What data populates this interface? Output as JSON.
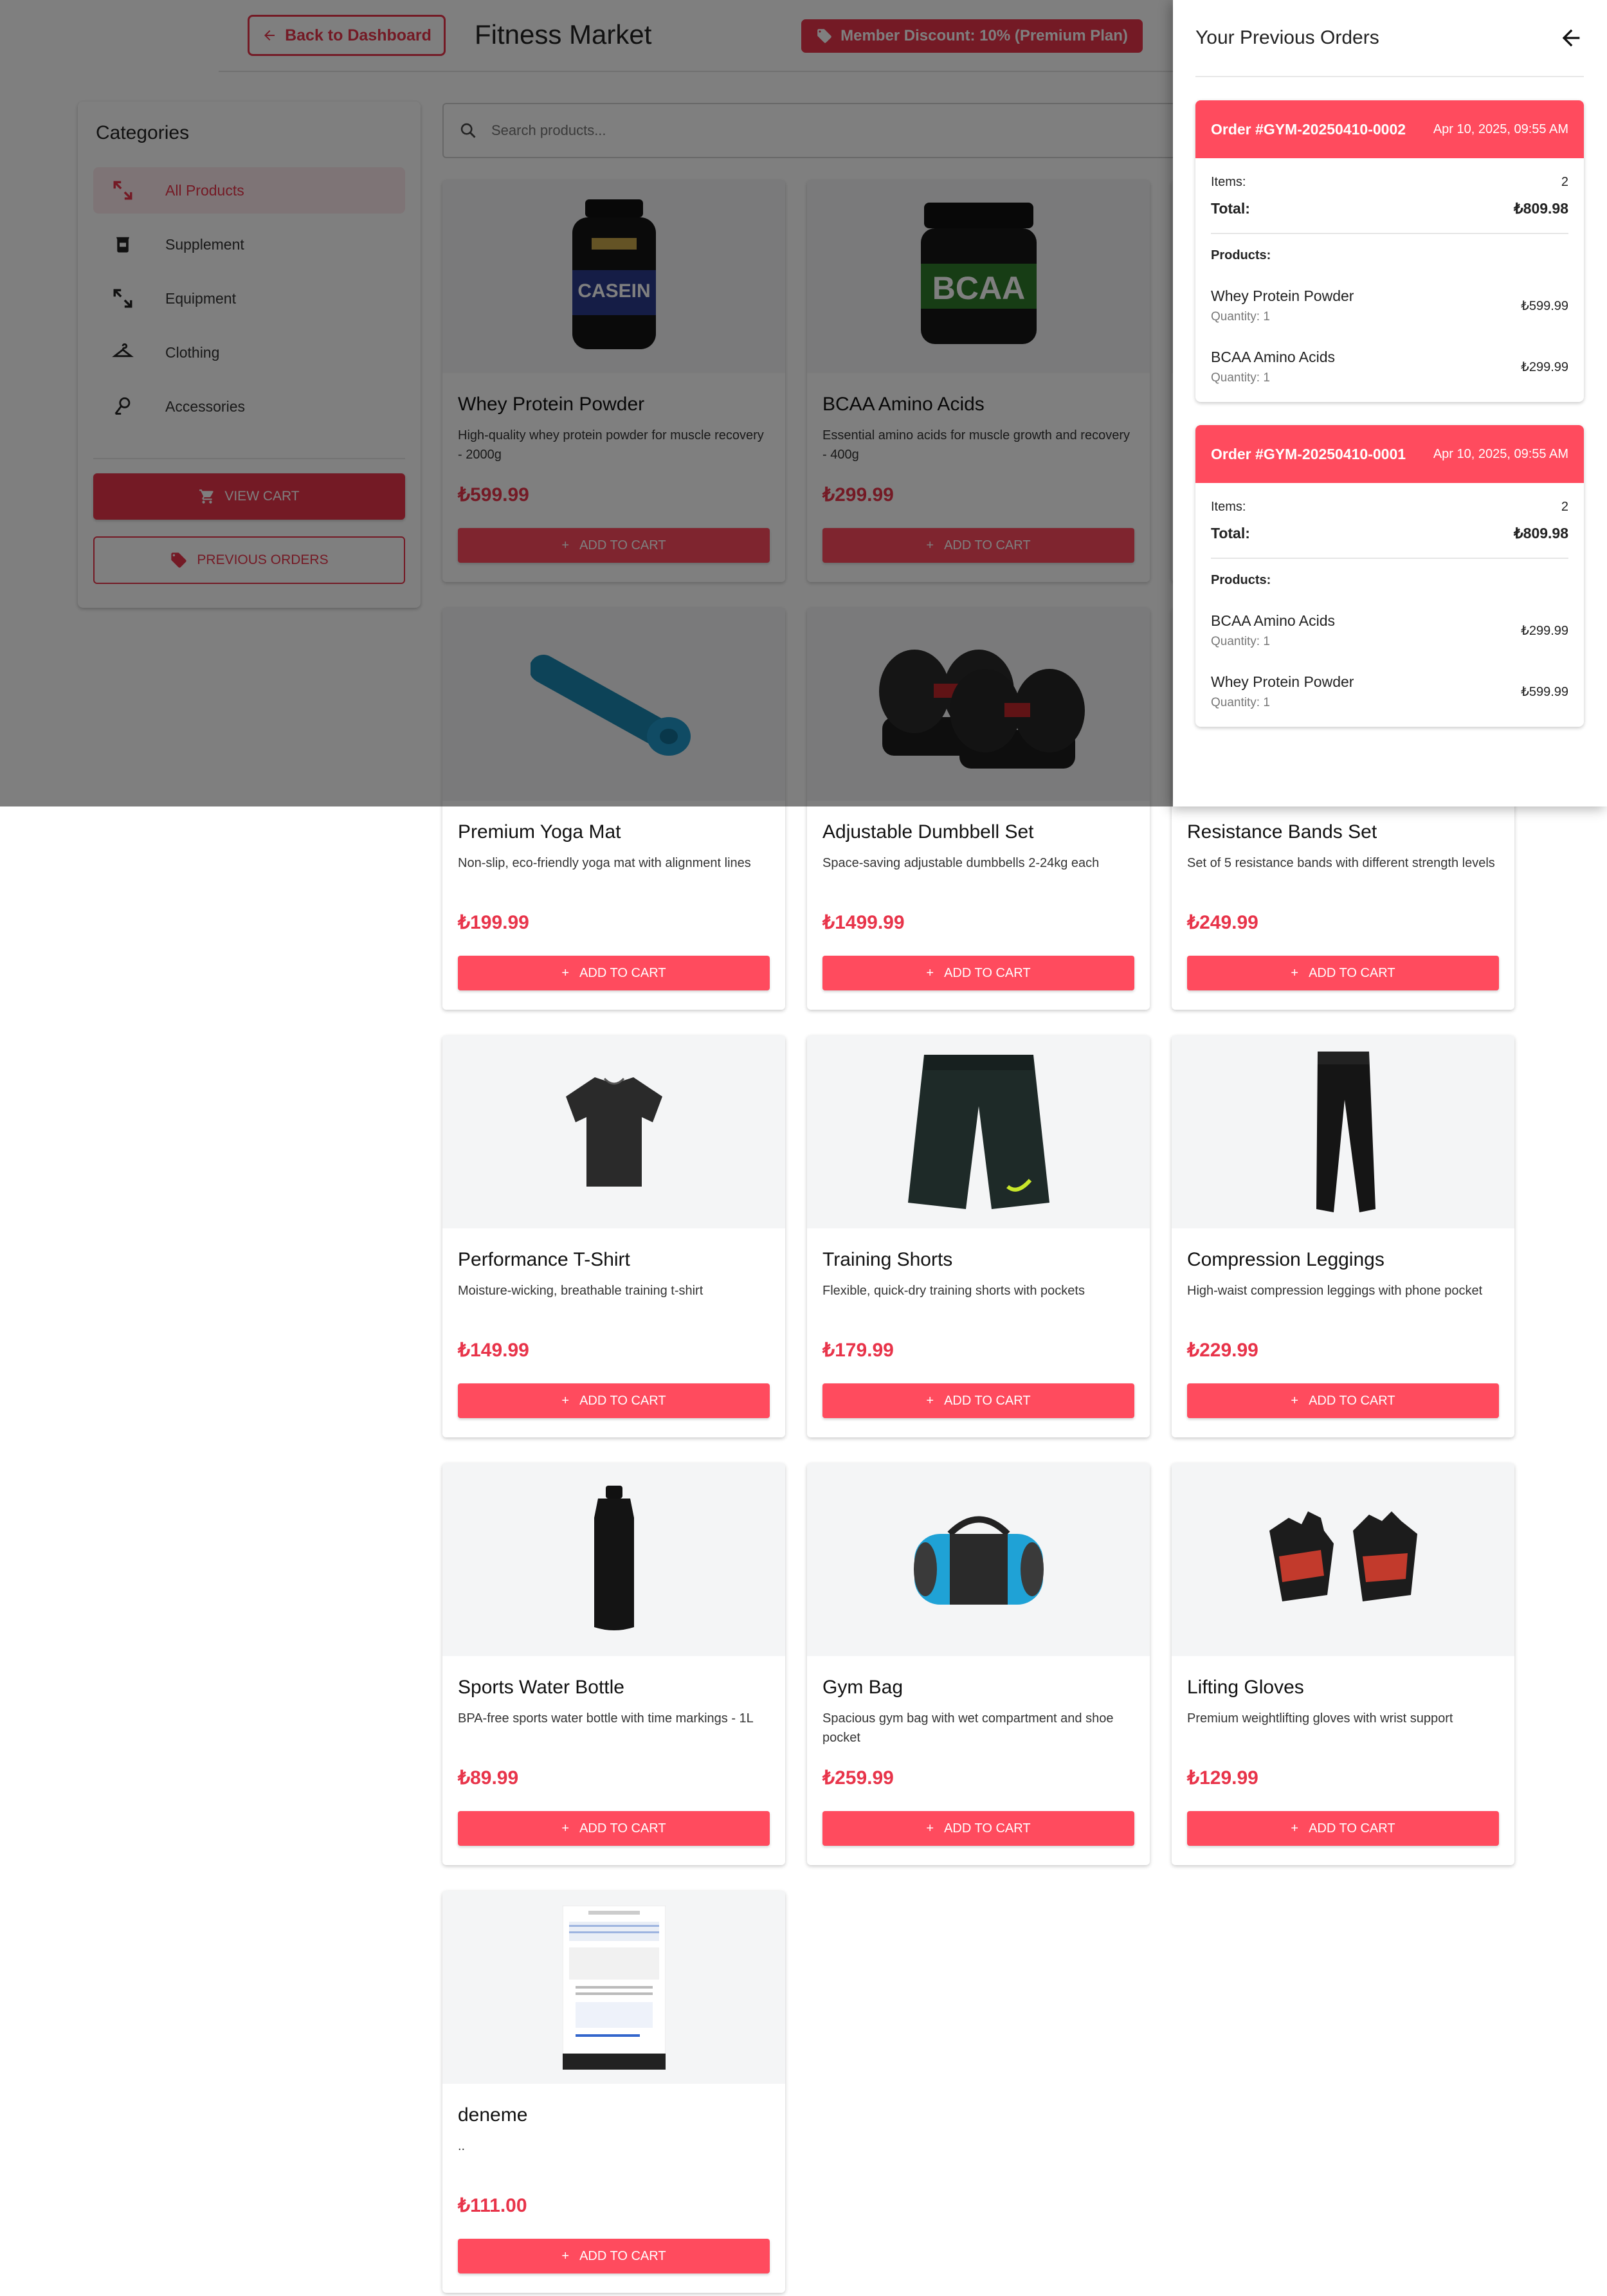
{
  "header": {
    "back_label": "Back to Dashboard",
    "title": "Fitness Market",
    "discount_badge": "Member Discount: 10% (Premium Plan)"
  },
  "sidebar": {
    "title": "Categories",
    "items": [
      {
        "label": "All Products",
        "icon": "all-products-icon",
        "active": true
      },
      {
        "label": "Supplement",
        "icon": "supplement-icon",
        "active": false
      },
      {
        "label": "Equipment",
        "icon": "equipment-icon",
        "active": false
      },
      {
        "label": "Clothing",
        "icon": "clothing-icon",
        "active": false
      },
      {
        "label": "Accessories",
        "icon": "accessories-icon",
        "active": false
      }
    ],
    "view_cart_label": "VIEW CART",
    "previous_orders_label": "PREVIOUS ORDERS"
  },
  "search": {
    "placeholder": "Search products..."
  },
  "products": [
    {
      "name": "Whey Protein Powder",
      "description": "High-quality whey protein powder for muscle recovery - 2000g",
      "price": "₺599.99",
      "button": "ADD TO CART",
      "image": "casein-tub"
    },
    {
      "name": "BCAA Amino Acids",
      "description": "Essential amino acids for muscle growth and recovery - 400g",
      "price": "₺299.99",
      "button": "ADD TO CART",
      "image": "bcaa-tub"
    },
    {
      "name": "",
      "description": "",
      "price": "",
      "button": "",
      "image": "hidden"
    },
    {
      "name": "Premium Yoga Mat",
      "description": "Non-slip, eco-friendly yoga mat with alignment lines",
      "price": "₺199.99",
      "button": "ADD TO CART",
      "image": "yoga-mat"
    },
    {
      "name": "Adjustable Dumbbell Set",
      "description": "Space-saving adjustable dumbbells 2-24kg each",
      "price": "₺1499.99",
      "button": "ADD TO CART",
      "image": "dumbbells"
    },
    {
      "name": "Resistance Bands Set",
      "description": "Set of 5 resistance bands with different strength levels",
      "price": "₺249.99",
      "button": "ADD TO CART",
      "image": "bands"
    },
    {
      "name": "Performance T-Shirt",
      "description": "Moisture-wicking, breathable training t-shirt",
      "price": "₺149.99",
      "button": "ADD TO CART",
      "image": "tshirt"
    },
    {
      "name": "Training Shorts",
      "description": "Flexible, quick-dry training shorts with pockets",
      "price": "₺179.99",
      "button": "ADD TO CART",
      "image": "shorts"
    },
    {
      "name": "Compression Leggings",
      "description": "High-waist compression leggings with phone pocket",
      "price": "₺229.99",
      "button": "ADD TO CART",
      "image": "leggings"
    },
    {
      "name": "Sports Water Bottle",
      "description": "BPA-free sports water bottle with time markings - 1L",
      "price": "₺89.99",
      "button": "ADD TO CART",
      "image": "bottle"
    },
    {
      "name": "Gym Bag",
      "description": "Spacious gym bag with wet compartment and shoe pocket",
      "price": "₺259.99",
      "button": "ADD TO CART",
      "image": "gymbag"
    },
    {
      "name": "Lifting Gloves",
      "description": "Premium weightlifting gloves with wrist support",
      "price": "₺129.99",
      "button": "ADD TO CART",
      "image": "gloves"
    },
    {
      "name": "deneme",
      "description": "..",
      "price": "₺111.00",
      "button": "ADD TO CART",
      "image": "screenshot"
    }
  ],
  "orders_panel": {
    "title": "Your Previous Orders",
    "items_label": "Items:",
    "total_label": "Total:",
    "products_label": "Products:",
    "orders": [
      {
        "id": "Order #GYM-20250410-0002",
        "date": "Apr 10, 2025, 09:55 AM",
        "items": "2",
        "total": "₺809.98",
        "products": [
          {
            "name": "Whey Protein Powder",
            "quantity": "Quantity: 1",
            "price": "₺599.99"
          },
          {
            "name": "BCAA Amino Acids",
            "quantity": "Quantity: 1",
            "price": "₺299.99"
          }
        ]
      },
      {
        "id": "Order #GYM-20250410-0001",
        "date": "Apr 10, 2025, 09:55 AM",
        "items": "2",
        "total": "₺809.98",
        "products": [
          {
            "name": "BCAA Amino Acids",
            "quantity": "Quantity: 1",
            "price": "₺299.99"
          },
          {
            "name": "Whey Protein Powder",
            "quantity": "Quantity: 1",
            "price": "₺599.99"
          }
        ]
      }
    ]
  },
  "colors": {
    "accent": "#e8344a",
    "button": "#ff4b5e",
    "overlay": "rgba(0,0,0,0.5)"
  }
}
